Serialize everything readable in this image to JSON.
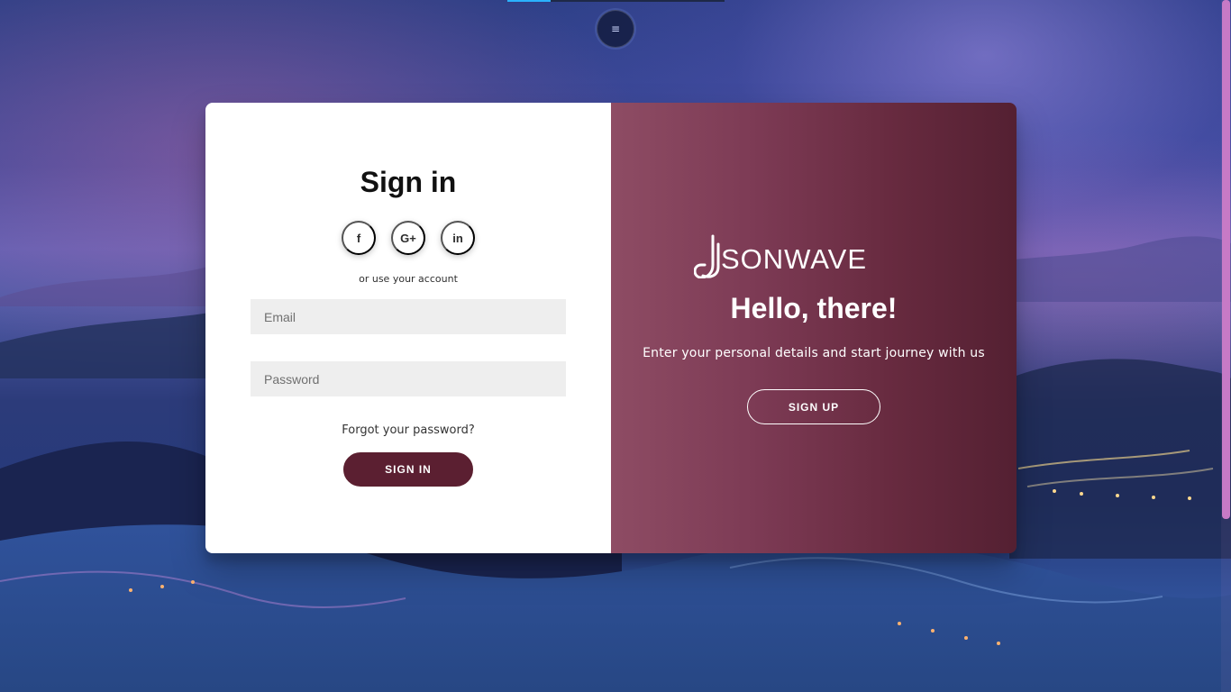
{
  "nav": {
    "menu_icon": "menu-icon",
    "menu_glyph": "≡"
  },
  "theme": {
    "primary": "#5b1f31",
    "panel_gradient_start": "#8e4c64",
    "panel_gradient_end": "#542032",
    "field_bg": "#eeeeee",
    "scroll_thumb": "#c77ac6",
    "top_tab_accent": "#2ab2ff"
  },
  "signin": {
    "title": "Sign in",
    "social_buttons": [
      {
        "name": "facebook",
        "icon": "facebook-icon",
        "label": "f"
      },
      {
        "name": "google-plus",
        "icon": "google-plus-icon",
        "label": "G+"
      },
      {
        "name": "linkedin",
        "icon": "linkedin-icon",
        "label": "in"
      }
    ],
    "alternate_text": "or use your account",
    "email": {
      "placeholder": "Email",
      "value": ""
    },
    "password": {
      "placeholder": "Password",
      "value": ""
    },
    "forgot_link": "Forgot your password?",
    "submit_label": "SIGN IN"
  },
  "signup": {
    "brand_name": "SONWAVE",
    "title": "Hello, there!",
    "subtitle": "Enter your personal details and start journey with us",
    "button_label": "SIGN UP"
  }
}
